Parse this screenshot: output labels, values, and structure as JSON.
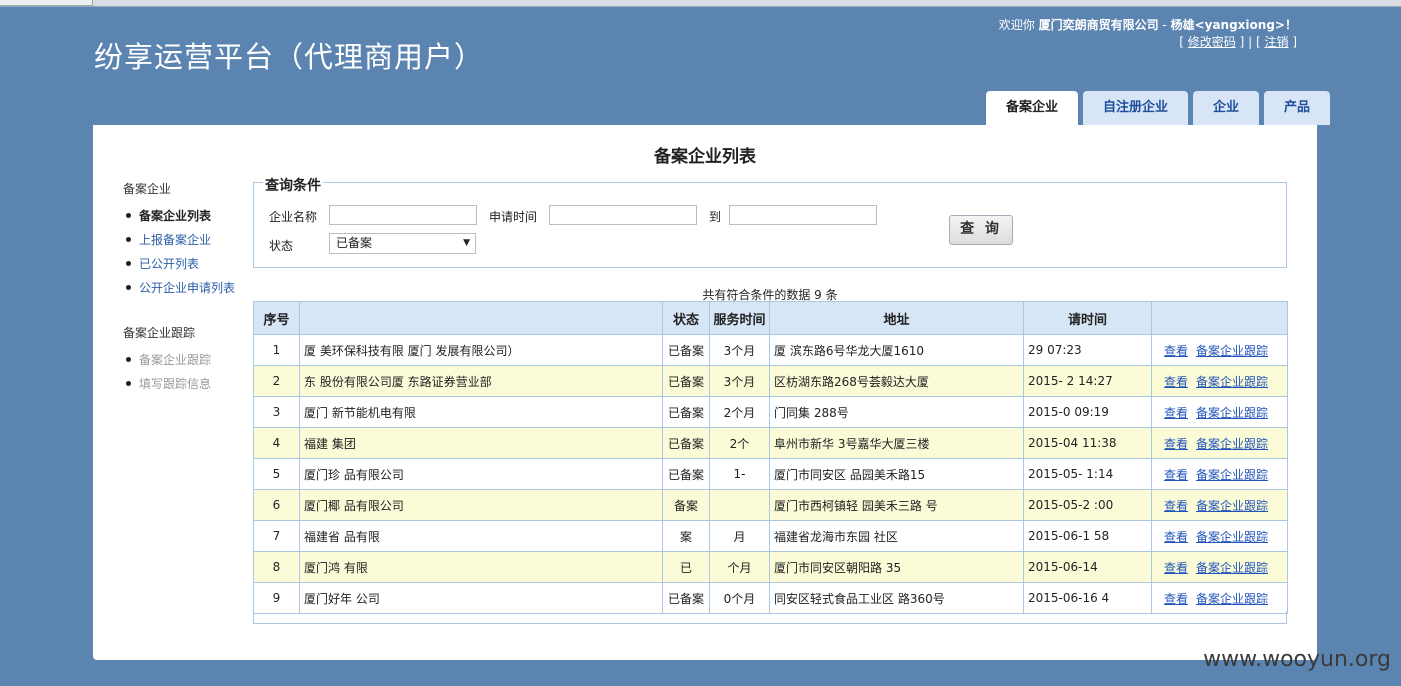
{
  "header": {
    "app_title": "纷享运营平台（代理商用户）",
    "welcome_prefix": "欢迎你 ",
    "company": "厦门奕朗商贸有限公司",
    "separator": " - ",
    "user": "杨雄<yangxiong>",
    "exclaim": "！",
    "bracket_open": "[ ",
    "change_password": "修改密码",
    "mid_sep": " ] | [ ",
    "logout": "注销",
    "bracket_close": " ]"
  },
  "tabs": [
    {
      "label": "备案企业",
      "active": true
    },
    {
      "label": "自注册企业",
      "active": false
    },
    {
      "label": "企业",
      "active": false
    },
    {
      "label": "产品",
      "active": false
    }
  ],
  "page_title": "备案企业列表",
  "sidebar": {
    "section1": "备案企业",
    "items1": [
      "备案企业列表",
      "上报备案企业",
      "已公开列表",
      "公开企业申请列表"
    ],
    "section2": "备案企业跟踪",
    "items2": [
      "备案企业跟踪",
      "填写跟踪信息"
    ]
  },
  "query": {
    "legend": "查询条件",
    "company_label": "企业名称",
    "apply_time_label": "申请时间",
    "to_label": "到",
    "status_label": "状态",
    "status_value": "已备案",
    "search_button": "查 询"
  },
  "count_text": "共有符合条件的数据 9 条",
  "table": {
    "columns": [
      "序号",
      "",
      "状态",
      "服务时间",
      "地址",
      "请时间",
      ""
    ],
    "rows": [
      {
        "no": "1",
        "name": "厦 美环保科技有限 厦门 发展有限公司）",
        "status": "已备案",
        "service": "3个月",
        "address": "厦 滨东路6号华龙大厦1610",
        "time": "29 07:23"
      },
      {
        "no": "2",
        "name": "东 股份有限公司厦 东路证券营业部",
        "status": "已备案",
        "service": "3个月",
        "address": "区枋湖东路268号荟毅达大厦",
        "time": "2015- 2 14:27"
      },
      {
        "no": "3",
        "name": "厦门 新节能机电有限",
        "status": "已备案",
        "service": "2个月",
        "address": "门同集 288号",
        "time": "2015-0 09:19"
      },
      {
        "no": "4",
        "name": "福建 集团",
        "status": "已备案",
        "service": "2个",
        "address": "阜州市新华 3号嘉华大厦三楼",
        "time": "2015-04 11:38"
      },
      {
        "no": "5",
        "name": "厦门珍 品有限公司",
        "status": "已备案",
        "service": "1-",
        "address": "厦门市同安区 品园美禾路15",
        "time": "2015-05- 1:14"
      },
      {
        "no": "6",
        "name": "厦门椰 品有限公司",
        "status": "备案",
        "service": "",
        "address": "厦门市西柯镇轻 园美禾三路 号",
        "time": "2015-05-2 :00"
      },
      {
        "no": "7",
        "name": "福建省 品有限",
        "status": "案",
        "service": "月",
        "address": "福建省龙海市东园 社区",
        "time": "2015-06-1 58"
      },
      {
        "no": "8",
        "name": "厦门鸿 有限",
        "status": "已",
        "service": "个月",
        "address": "厦门市同安区朝阳路 35",
        "time": "2015-06-14"
      },
      {
        "no": "9",
        "name": "厦门好年 公司",
        "status": "已备案",
        "service": "0个月",
        "address": "同安区轻式食品工业区 路360号",
        "time": "2015-06-16 4"
      }
    ],
    "view_label": "查看",
    "track_label": "备案企业跟踪"
  },
  "watermark": "www.wooyun.org"
}
